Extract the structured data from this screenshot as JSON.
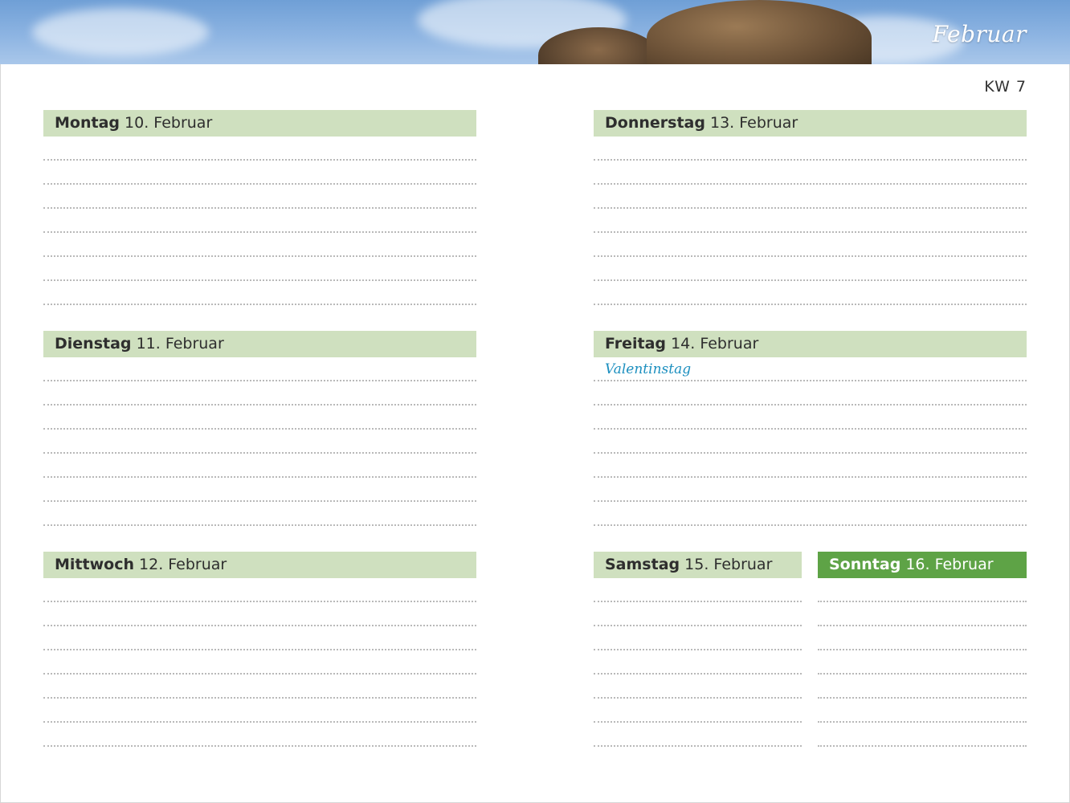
{
  "header": {
    "month": "Februar",
    "week": "KW 7"
  },
  "days": {
    "monday": {
      "name": "Montag",
      "date": "10. Februar"
    },
    "tuesday": {
      "name": "Dienstag",
      "date": "11. Februar"
    },
    "wednesday": {
      "name": "Mittwoch",
      "date": "12. Februar"
    },
    "thursday": {
      "name": "Donnerstag",
      "date": "13. Februar"
    },
    "friday": {
      "name": "Freitag",
      "date": "14. Februar",
      "note": "Valentinstag"
    },
    "saturday": {
      "name": "Samstag",
      "date": "15. Februar"
    },
    "sunday": {
      "name": "Sonntag",
      "date": "16. Februar"
    }
  },
  "colors": {
    "header_bg": "#cfe0bf",
    "sunday_bg": "#5ea346",
    "note": "#1c8fbf"
  }
}
